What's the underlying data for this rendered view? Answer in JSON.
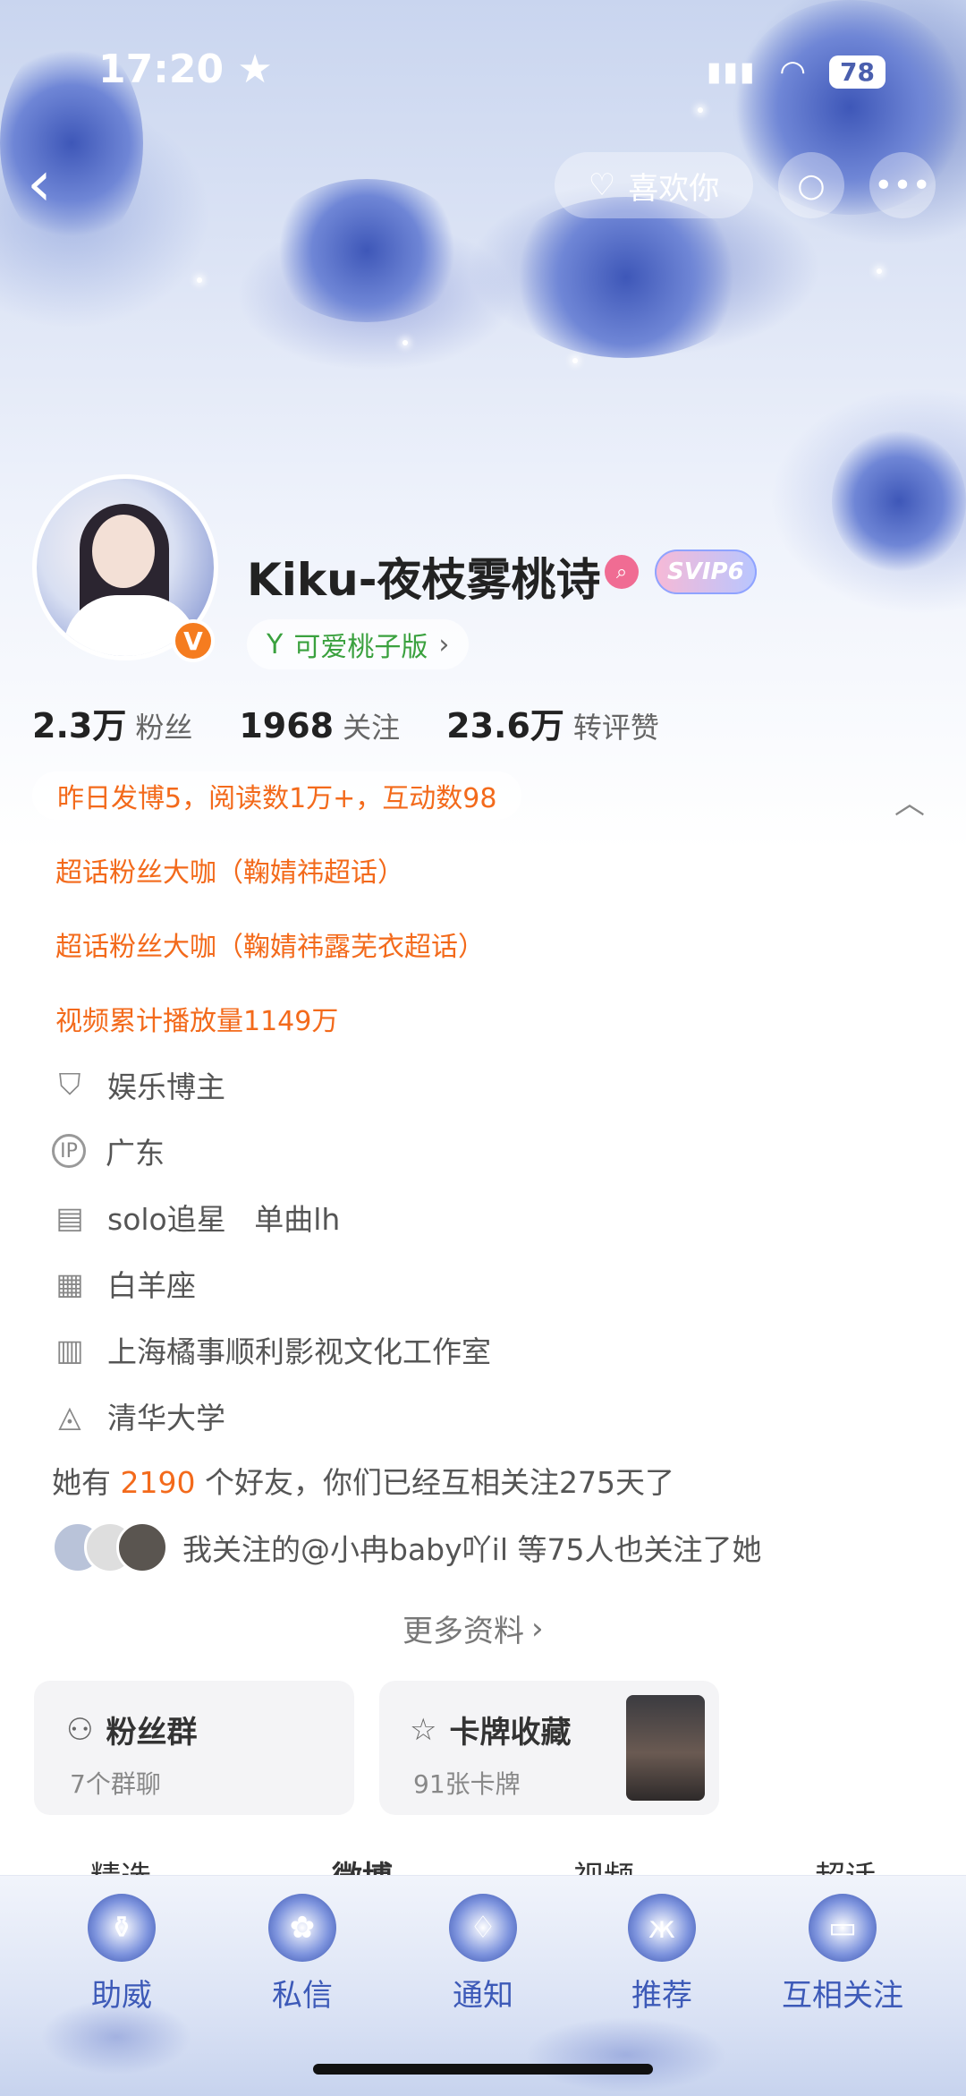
{
  "status_bar": {
    "time": "17:20",
    "battery": "78"
  },
  "header": {
    "like_label": "喜欢你"
  },
  "profile": {
    "username": "Kiku-夜枝雾桃诗",
    "vip_badge": "SVIP6",
    "verified_badge": "V",
    "version_label": "可爱桃子版",
    "stats": [
      {
        "value": "2.3万",
        "label": "粉丝"
      },
      {
        "value": "1968",
        "label": "关注"
      },
      {
        "value": "23.6万",
        "label": "转评赞"
      }
    ]
  },
  "highlights": {
    "summary": "昨日发博5，阅读数1万+，互动数98",
    "lines": [
      "超话粉丝大咖（鞠婧祎超话）",
      "超话粉丝大咖（鞠婧祎露芜衣超话）",
      "视频累计播放量1149万"
    ]
  },
  "info": [
    {
      "icon": "verified-shield-icon",
      "text": "娱乐博主"
    },
    {
      "icon": "ip-location-icon",
      "text": "广东"
    },
    {
      "icon": "document-icon",
      "text": "solo追星   单曲lh"
    },
    {
      "icon": "calendar-icon",
      "text": "白羊座"
    },
    {
      "icon": "company-building-icon",
      "text": "上海橘事顺利影视文化工作室"
    },
    {
      "icon": "graduation-cap-icon",
      "text": "清华大学"
    }
  ],
  "friends": {
    "prefix": "她有",
    "count": "2190",
    "suffix": "个好友，你们已经互相关注275天了",
    "mutual_text": "我关注的@小冉baby吖il 等75人也关注了她"
  },
  "more_info_label": "更多资料",
  "cards": {
    "fan_group": {
      "title": "粉丝群",
      "subtitle": "7个群聊"
    },
    "card_collection": {
      "title": "卡牌收藏",
      "subtitle": "91张卡牌"
    }
  },
  "tabs": [
    "精选",
    "微博",
    "视频",
    "超话"
  ],
  "bottom_nav": [
    "助威",
    "私信",
    "通知",
    "推荐",
    "互相关注"
  ]
}
